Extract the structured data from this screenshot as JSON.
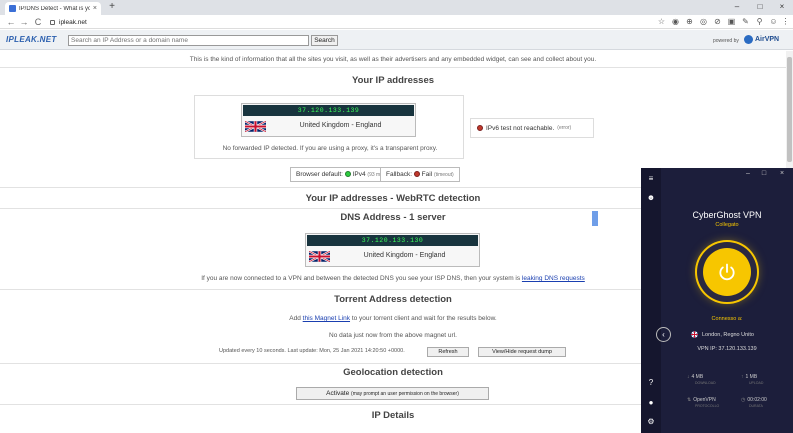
{
  "browser": {
    "tab_title": "IP/DNS Detect - What is your IP",
    "tab_close": "×",
    "new_tab": "+",
    "window_min": "–",
    "window_max": "□",
    "window_close": "×",
    "back": "←",
    "forward": "→",
    "reload": "C",
    "url": "ipleak.net",
    "ext_icons": [
      "☆",
      "◉",
      "⊕",
      "◎",
      "⊘",
      "▣",
      "✎",
      "⚲",
      "★",
      "☺",
      "⋮"
    ]
  },
  "header": {
    "logo": "IPLEAK.NET",
    "search_placeholder": "Search an IP Address or a domain name",
    "search_button": "Search",
    "powered_by": "powered by",
    "airvpn": "AirVPN"
  },
  "page": {
    "intro": "This is the kind of information that all the sites you visit, as well as their advertisers and any embedded widget, can see and collect about you.",
    "ip_section_title": "Your IP addresses",
    "ip_card": {
      "ip": "37.120.133.139",
      "location": "United Kingdom - England"
    },
    "forward_note": "No forwarded IP detected. If you are using a proxy, it's a transparent proxy.",
    "ipv6_text": "IPv6 test not reachable.",
    "ipv6_small": "(error)",
    "browser_default_label": "Browser default:",
    "browser_default_value": "IPv4",
    "browser_default_ms": "(93 ms)",
    "fallback_label": "Fallback:",
    "fallback_value": "Fail",
    "fallback_small": "(timeout)",
    "webrtc_title": "Your IP addresses - WebRTC detection",
    "dns_title": "DNS Address - 1 server",
    "dns_card": {
      "ip": "37.120.133.130",
      "location": "United Kingdom - England"
    },
    "dns_note": "If you are now connected to a VPN and between the detected DNS you see your ISP DNS, then your system is",
    "dns_link": "leaking DNS requests",
    "torrent_title": "Torrent Address detection",
    "torrent_add": "Add",
    "torrent_link": "this Magnet Link",
    "torrent_rest": "to your torrent client and wait for the results below.",
    "torrent_nodata": "No data just now from the above magnet url.",
    "torrent_updated": "Updated every 10 seconds. Last update: Mon, 25 Jan 2021 14:20:50 +0000.",
    "refresh_btn": "Refresh",
    "dump_btn": "View/Hide request dump",
    "geo_title": "Geolocation detection",
    "activate_btn": "Activate",
    "activate_small": "(may prompt an user permission on the browser)",
    "ipdetails_title": "IP Details"
  },
  "cyberghost": {
    "title": "CyberGhost VPN",
    "subtitle": "Collegato",
    "status": "Connesso a:",
    "location": "London, Regno Unito",
    "vpn_ip": "VPN IP: 37.120.133.139",
    "download": "4 MB",
    "download_label": "DOWNLOAD",
    "upload": "1 MB",
    "upload_label": "UPLOAD",
    "protocol": "OpenVPN",
    "protocol_label": "PROTOCOLLO",
    "duration": "00:02:00",
    "duration_label": "DURATA",
    "accent_color": "#f7c600"
  }
}
